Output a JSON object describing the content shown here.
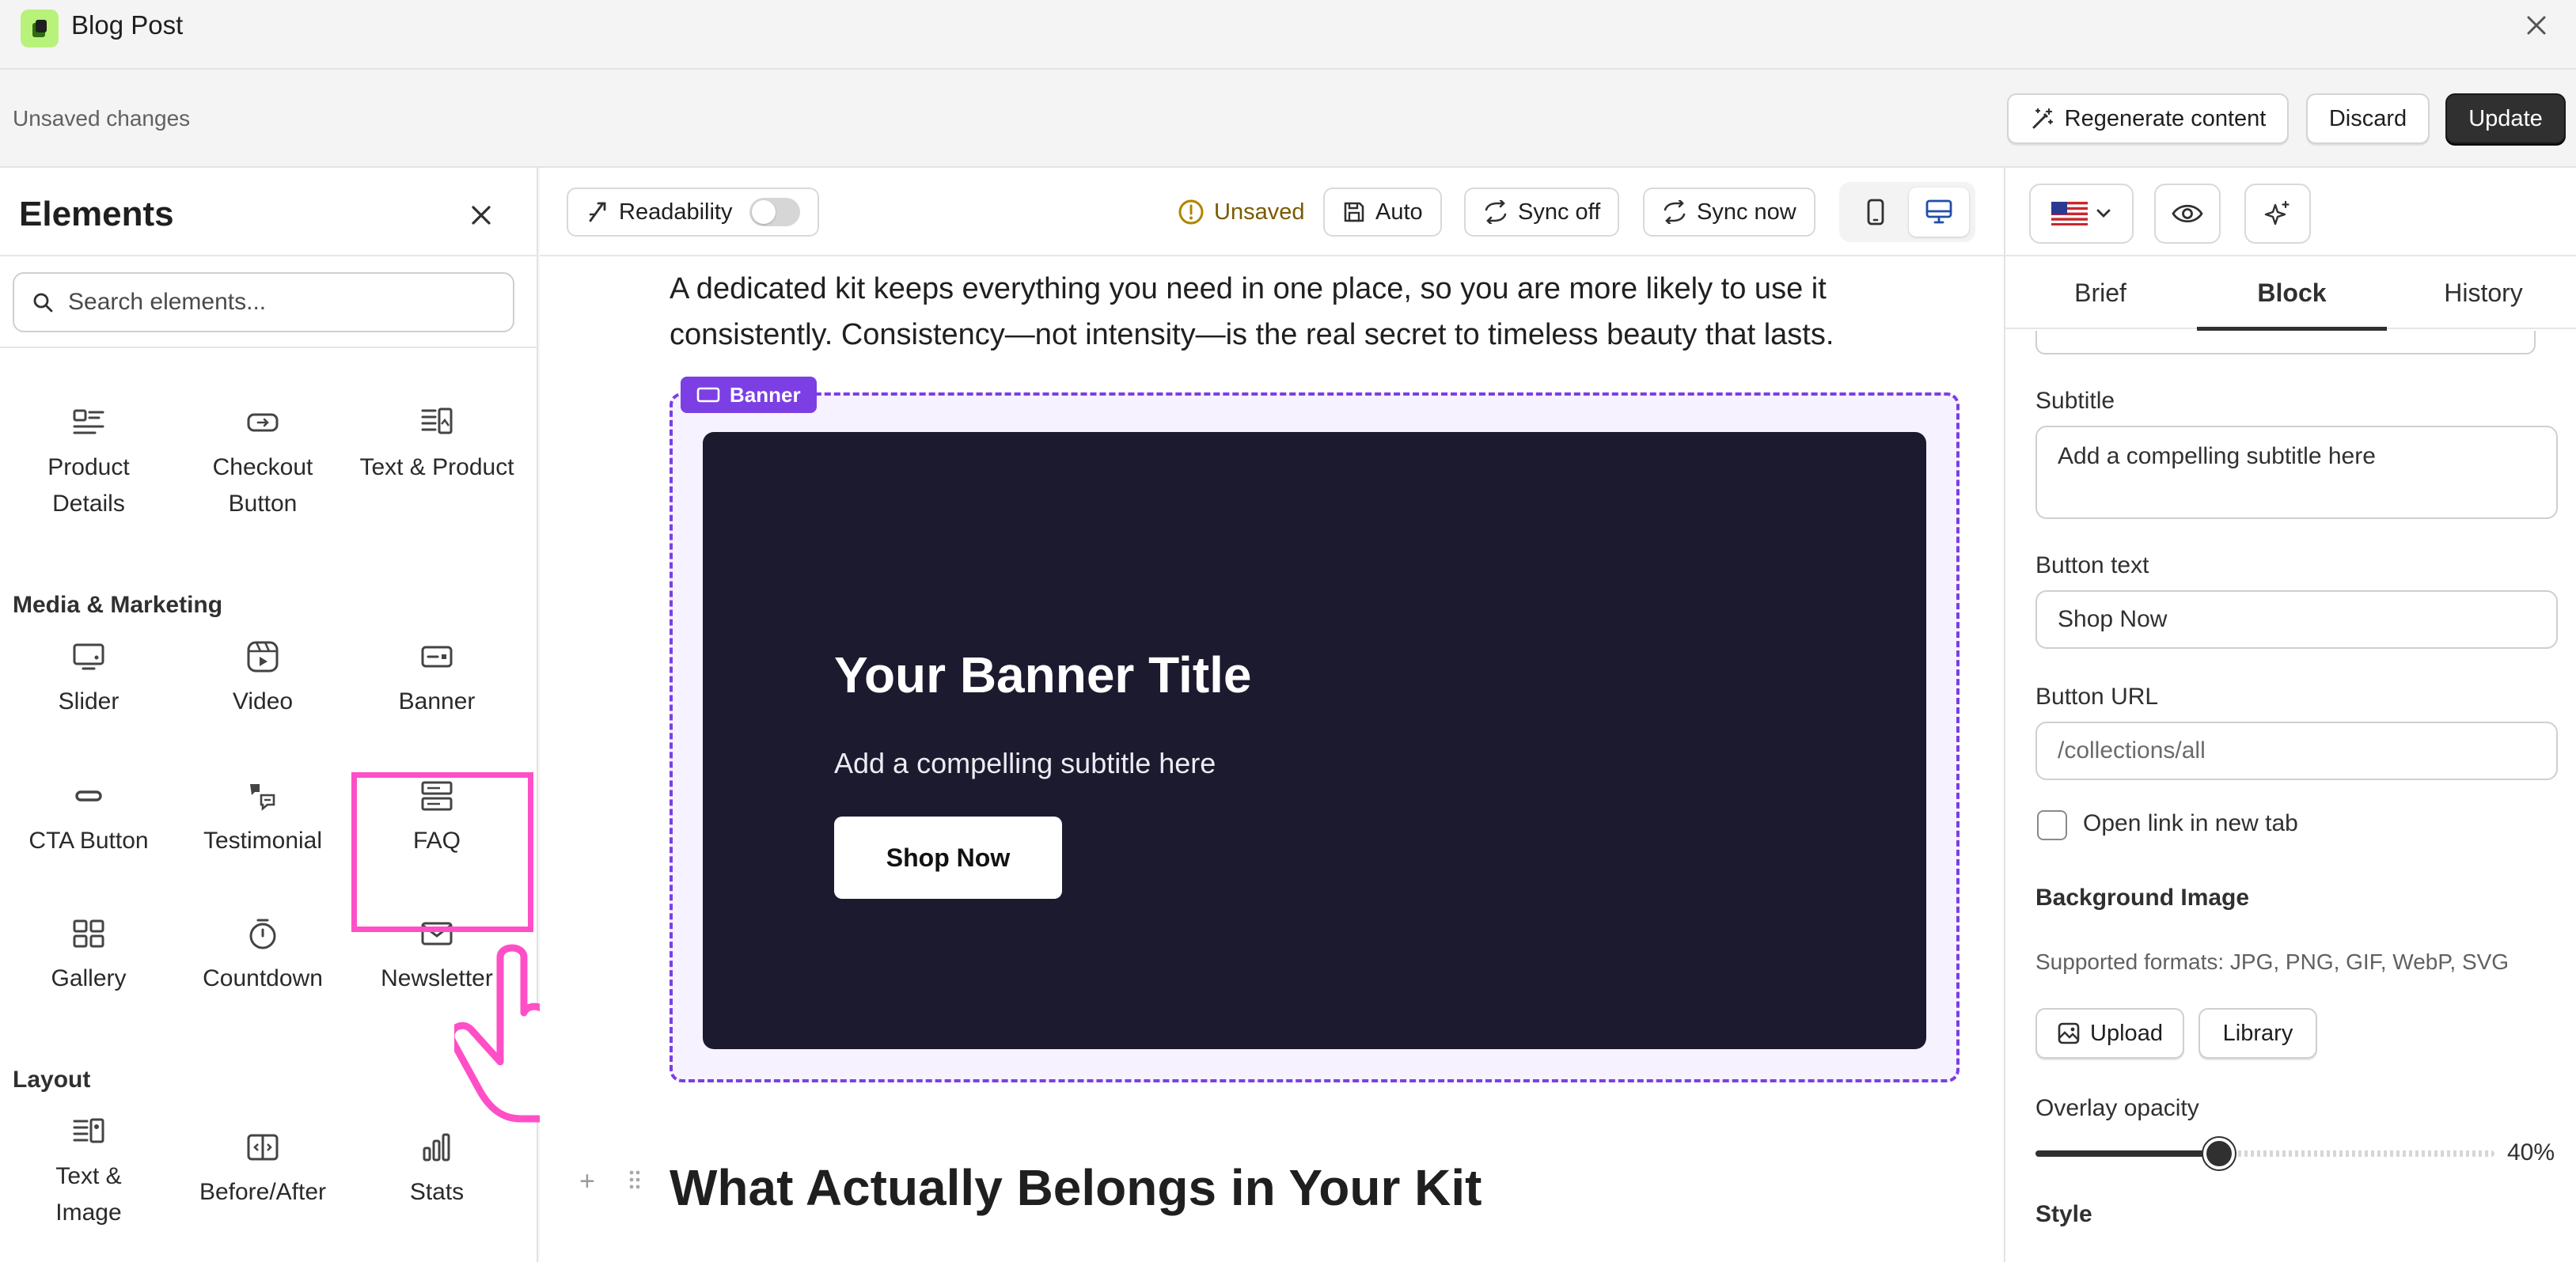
{
  "window": {
    "title": "Blog Post"
  },
  "actionbar": {
    "status": "Unsaved changes",
    "regenerate_label": "Regenerate content",
    "discard_label": "Discard",
    "update_label": "Update"
  },
  "sidebar": {
    "title": "Elements",
    "search_placeholder": "Search elements...",
    "top_items": [
      {
        "label": "Product Details",
        "icon": "product-details-icon"
      },
      {
        "label": "Checkout Button",
        "icon": "checkout-button-icon"
      },
      {
        "label": "Text & Product",
        "icon": "text-product-icon"
      }
    ],
    "media_section": "Media & Marketing",
    "media_items": [
      {
        "label": "Slider",
        "icon": "slider-icon"
      },
      {
        "label": "Video",
        "icon": "video-icon"
      },
      {
        "label": "Banner",
        "icon": "banner-icon"
      },
      {
        "label": "CTA Button",
        "icon": "cta-button-icon"
      },
      {
        "label": "Testimonial",
        "icon": "testimonial-icon"
      },
      {
        "label": "FAQ",
        "icon": "faq-icon"
      },
      {
        "label": "Gallery",
        "icon": "gallery-icon"
      },
      {
        "label": "Countdown",
        "icon": "countdown-icon"
      },
      {
        "label": "Newsletter",
        "icon": "newsletter-icon"
      }
    ],
    "layout_section": "Layout",
    "layout_items": [
      {
        "label": "Text & Image",
        "icon": "text-image-icon"
      },
      {
        "label": "Before/After",
        "icon": "before-after-icon"
      },
      {
        "label": "Stats",
        "icon": "stats-icon"
      }
    ]
  },
  "toolbar": {
    "readability_label": "Readability",
    "readability_on": false,
    "unsaved_label": "Unsaved",
    "auto_label": "Auto",
    "sync_off_label": "Sync off",
    "sync_now_label": "Sync now",
    "active_device": "desktop"
  },
  "content": {
    "paragraph": "A dedicated kit keeps everything you need in one place, so you are more likely to use it consistently. Consistency—not intensity—is the real secret to timeless beauty that lasts.",
    "banner_tag": "Banner",
    "banner": {
      "title": "Your Banner Title",
      "subtitle": "Add a compelling subtitle here",
      "button": "Shop Now"
    },
    "heading": "What Actually Belongs in Your Kit"
  },
  "right_panel": {
    "locale_flag": "us-flag-icon",
    "tabs": [
      "Brief",
      "Block",
      "History"
    ],
    "active_tab": "Block",
    "fields": {
      "subtitle_label": "Subtitle",
      "subtitle_value": "Add a compelling subtitle here",
      "button_text_label": "Button text",
      "button_text_value": "Shop Now",
      "button_url_label": "Button URL",
      "button_url_placeholder": "/collections/all",
      "open_new_tab_label": "Open link in new tab",
      "open_new_tab_checked": false,
      "bg_image_label": "Background Image",
      "bg_image_hint": "Supported formats: JPG, PNG, GIF, WebP, SVG",
      "upload_label": "Upload",
      "library_label": "Library",
      "overlay_label": "Overlay opacity",
      "overlay_value_text": "40%",
      "overlay_value": 0.4,
      "style_label": "Style"
    }
  },
  "colors": {
    "accent_purple": "#7b3fe4",
    "banner_bg": "#1c1a2e",
    "highlight_pink": "#ff4fc7",
    "primary_dark": "#303030",
    "app_icon_green": "#b8f27b"
  }
}
